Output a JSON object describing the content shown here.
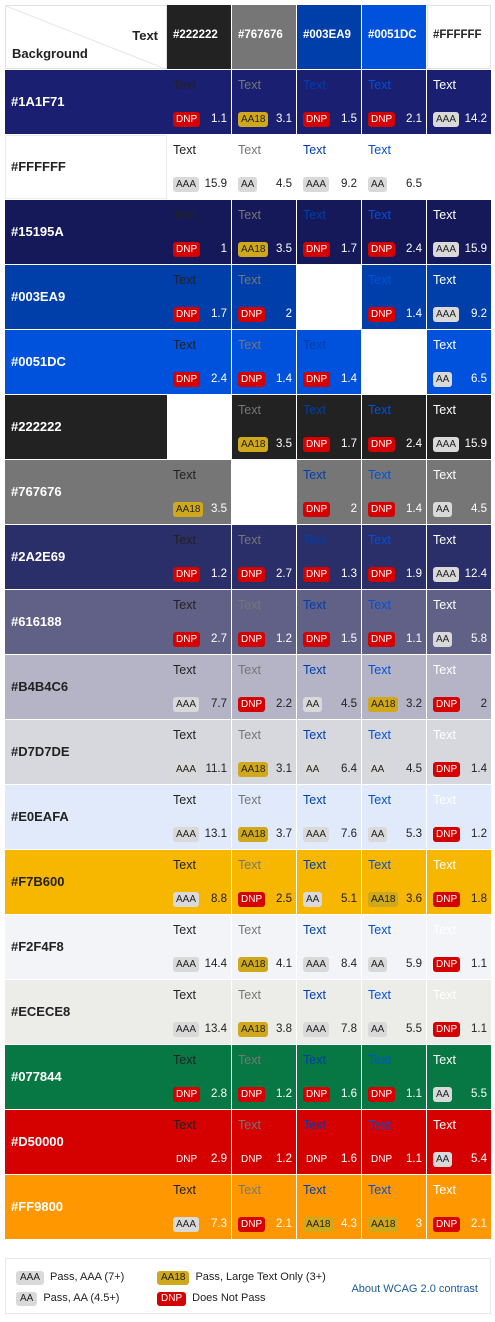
{
  "header": {
    "text_label": "Text",
    "background_label": "Background",
    "columns": [
      {
        "name": "#222222",
        "color": "#222222",
        "label_color": "#ffffff"
      },
      {
        "name": "#767676",
        "color": "#767676",
        "label_color": "#ffffff"
      },
      {
        "name": "#003EA9",
        "color": "#003EA9",
        "label_color": "#ffffff"
      },
      {
        "name": "#0051DC",
        "color": "#0051DC",
        "label_color": "#ffffff"
      },
      {
        "name": "#FFFFFF",
        "color": "#FFFFFF",
        "label_color": "#222222"
      }
    ]
  },
  "cell_text": "Text",
  "rows": [
    {
      "name": "#1A1F71",
      "bg": "#1A1F71",
      "label_color": "#ffffff",
      "cells": [
        {
          "r": "DNP",
          "v": "1.1"
        },
        {
          "r": "AA18",
          "v": "3.1"
        },
        {
          "r": "DNP",
          "v": "1.5"
        },
        {
          "r": "DNP",
          "v": "2.1"
        },
        {
          "r": "AAA",
          "v": "14.2"
        }
      ]
    },
    {
      "name": "#FFFFFF",
      "bg": "#FFFFFF",
      "label_color": "#222222",
      "cells": [
        {
          "r": "AAA",
          "v": "15.9"
        },
        {
          "r": "AA",
          "v": "4.5"
        },
        {
          "r": "AAA",
          "v": "9.2"
        },
        {
          "r": "AA",
          "v": "6.5"
        },
        null
      ]
    },
    {
      "name": "#15195A",
      "bg": "#15195A",
      "label_color": "#ffffff",
      "cells": [
        {
          "r": "DNP",
          "v": "1"
        },
        {
          "r": "AA18",
          "v": "3.5"
        },
        {
          "r": "DNP",
          "v": "1.7"
        },
        {
          "r": "DNP",
          "v": "2.4"
        },
        {
          "r": "AAA",
          "v": "15.9"
        }
      ]
    },
    {
      "name": "#003EA9",
      "bg": "#003EA9",
      "label_color": "#ffffff",
      "cells": [
        {
          "r": "DNP",
          "v": "1.7"
        },
        {
          "r": "DNP",
          "v": "2"
        },
        null,
        {
          "r": "DNP",
          "v": "1.4"
        },
        {
          "r": "AAA",
          "v": "9.2"
        }
      ]
    },
    {
      "name": "#0051DC",
      "bg": "#0051DC",
      "label_color": "#ffffff",
      "cells": [
        {
          "r": "DNP",
          "v": "2.4"
        },
        {
          "r": "DNP",
          "v": "1.4"
        },
        {
          "r": "DNP",
          "v": "1.4"
        },
        null,
        {
          "r": "AA",
          "v": "6.5"
        }
      ]
    },
    {
      "name": "#222222",
      "bg": "#222222",
      "label_color": "#ffffff",
      "cells": [
        null,
        {
          "r": "AA18",
          "v": "3.5"
        },
        {
          "r": "DNP",
          "v": "1.7"
        },
        {
          "r": "DNP",
          "v": "2.4"
        },
        {
          "r": "AAA",
          "v": "15.9"
        }
      ]
    },
    {
      "name": "#767676",
      "bg": "#767676",
      "label_color": "#ffffff",
      "cells": [
        {
          "r": "AA18",
          "v": "3.5"
        },
        null,
        {
          "r": "DNP",
          "v": "2"
        },
        {
          "r": "DNP",
          "v": "1.4"
        },
        {
          "r": "AA",
          "v": "4.5"
        }
      ]
    },
    {
      "name": "#2A2E69",
      "bg": "#2A2E69",
      "label_color": "#ffffff",
      "cells": [
        {
          "r": "DNP",
          "v": "1.2"
        },
        {
          "r": "DNP",
          "v": "2.7"
        },
        {
          "r": "DNP",
          "v": "1.3"
        },
        {
          "r": "DNP",
          "v": "1.9"
        },
        {
          "r": "AAA",
          "v": "12.4"
        }
      ]
    },
    {
      "name": "#616188",
      "bg": "#616188",
      "label_color": "#ffffff",
      "cells": [
        {
          "r": "DNP",
          "v": "2.7"
        },
        {
          "r": "DNP",
          "v": "1.2"
        },
        {
          "r": "DNP",
          "v": "1.5"
        },
        {
          "r": "DNP",
          "v": "1.1"
        },
        {
          "r": "AA",
          "v": "5.8"
        }
      ]
    },
    {
      "name": "#B4B4C6",
      "bg": "#B4B4C6",
      "label_color": "#222222",
      "cells": [
        {
          "r": "AAA",
          "v": "7.7"
        },
        {
          "r": "DNP",
          "v": "2.2"
        },
        {
          "r": "AA",
          "v": "4.5"
        },
        {
          "r": "AA18",
          "v": "3.2"
        },
        {
          "r": "DNP",
          "v": "2"
        }
      ]
    },
    {
      "name": "#D7D7DE",
      "bg": "#D7D7DE",
      "label_color": "#222222",
      "cells": [
        {
          "r": "AAA",
          "v": "11.1"
        },
        {
          "r": "AA18",
          "v": "3.1"
        },
        {
          "r": "AA",
          "v": "6.4"
        },
        {
          "r": "AA",
          "v": "4.5"
        },
        {
          "r": "DNP",
          "v": "1.4"
        }
      ]
    },
    {
      "name": "#E0EAFA",
      "bg": "#E0EAFA",
      "label_color": "#222222",
      "cells": [
        {
          "r": "AAA",
          "v": "13.1"
        },
        {
          "r": "AA18",
          "v": "3.7"
        },
        {
          "r": "AAA",
          "v": "7.6"
        },
        {
          "r": "AA",
          "v": "5.3"
        },
        {
          "r": "DNP",
          "v": "1.2"
        }
      ]
    },
    {
      "name": "#F7B600",
      "bg": "#F7B600",
      "label_color": "#222222",
      "cells": [
        {
          "r": "AAA",
          "v": "8.8"
        },
        {
          "r": "DNP",
          "v": "2.5"
        },
        {
          "r": "AA",
          "v": "5.1"
        },
        {
          "r": "AA18",
          "v": "3.6"
        },
        {
          "r": "DNP",
          "v": "1.8"
        }
      ]
    },
    {
      "name": "#F2F4F8",
      "bg": "#F2F4F8",
      "label_color": "#222222",
      "cells": [
        {
          "r": "AAA",
          "v": "14.4"
        },
        {
          "r": "AA18",
          "v": "4.1"
        },
        {
          "r": "AAA",
          "v": "8.4"
        },
        {
          "r": "AA",
          "v": "5.9"
        },
        {
          "r": "DNP",
          "v": "1.1"
        }
      ]
    },
    {
      "name": "#ECECE8",
      "bg": "#ECECE8",
      "label_color": "#222222",
      "cells": [
        {
          "r": "AAA",
          "v": "13.4"
        },
        {
          "r": "AA18",
          "v": "3.8"
        },
        {
          "r": "AAA",
          "v": "7.8"
        },
        {
          "r": "AA",
          "v": "5.5"
        },
        {
          "r": "DNP",
          "v": "1.1"
        }
      ]
    },
    {
      "name": "#077844",
      "bg": "#077844",
      "label_color": "#ffffff",
      "cells": [
        {
          "r": "DNP",
          "v": "2.8"
        },
        {
          "r": "DNP",
          "v": "1.2"
        },
        {
          "r": "DNP",
          "v": "1.6"
        },
        {
          "r": "DNP",
          "v": "1.1"
        },
        {
          "r": "AA",
          "v": "5.5"
        }
      ]
    },
    {
      "name": "#D50000",
      "bg": "#D50000",
      "label_color": "#ffffff",
      "cells": [
        {
          "r": "DNP",
          "v": "2.9"
        },
        {
          "r": "DNP",
          "v": "1.2"
        },
        {
          "r": "DNP",
          "v": "1.6"
        },
        {
          "r": "DNP",
          "v": "1.1"
        },
        {
          "r": "AA",
          "v": "5.4"
        }
      ]
    },
    {
      "name": "#FF9800",
      "bg": "#FF9800",
      "label_color": "#ffffff",
      "cells": [
        {
          "r": "AAA",
          "v": "7.3"
        },
        {
          "r": "DNP",
          "v": "2.1"
        },
        {
          "r": "AA18",
          "v": "4.3"
        },
        {
          "r": "AA18",
          "v": "3"
        },
        {
          "r": "DNP",
          "v": "2.1"
        }
      ]
    }
  ],
  "legend": {
    "items": [
      {
        "badge": "AAA",
        "label": "Pass, AAA (7+)"
      },
      {
        "badge": "AA",
        "label": "Pass, AA (4.5+)"
      },
      {
        "badge": "AA18",
        "label": "Pass, Large Text Only (3+)"
      },
      {
        "badge": "DNP",
        "label": "Does Not Pass"
      }
    ],
    "about_link": "About WCAG 2.0 contrast"
  }
}
